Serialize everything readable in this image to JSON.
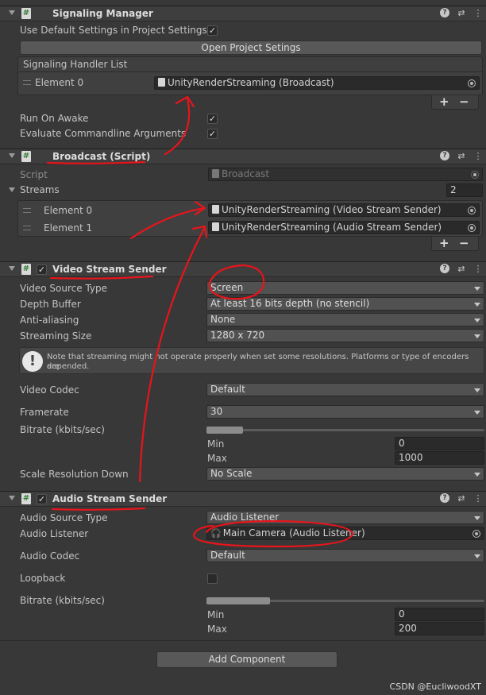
{
  "signaling": {
    "title": "Signaling Manager",
    "use_default_label": "Use Default Settings in Project Settings",
    "open_project_settings": "Open Project Setings",
    "handler_list_label": "Signaling Handler List",
    "element0_label": "Element 0",
    "element0_value": "UnityRenderStreaming (Broadcast)",
    "run_on_awake_label": "Run On Awake",
    "eval_cmd_label": "Evaluate Commandline Arguments",
    "plus": "+",
    "minus": "−"
  },
  "broadcast": {
    "title": "Broadcast (Script)",
    "script_label": "Script",
    "script_value": "Broadcast",
    "streams_label": "Streams",
    "streams_count": "2",
    "element0_label": "Element 0",
    "element0_value": "UnityRenderStreaming (Video Stream Sender)",
    "element1_label": "Element 1",
    "element1_value": "UnityRenderStreaming (Audio Stream Sender)",
    "plus": "+",
    "minus": "−"
  },
  "video": {
    "title": "Video Stream Sender",
    "source_type_label": "Video Source Type",
    "source_type_value": "Screen",
    "depth_label": "Depth Buffer",
    "depth_value": "At least 16 bits depth (no stencil)",
    "aa_label": "Anti-aliasing",
    "aa_value": "None",
    "size_label": "Streaming Size",
    "size_value": "1280 x 720",
    "note_line1": "Note that streaming might not operate properly when set some resolutions. Platforms or type of encoders are",
    "note_line2": "depended.",
    "codec_label": "Video Codec",
    "codec_value": "Default",
    "framerate_label": "Framerate",
    "framerate_value": "30",
    "bitrate_label": "Bitrate (kbits/sec)",
    "min_label": "Min",
    "min_value": "0",
    "max_label": "Max",
    "max_value": "1000",
    "scale_label": "Scale Resolution Down",
    "scale_value": "No Scale"
  },
  "audio": {
    "title": "Audio Stream Sender",
    "source_type_label": "Audio Source Type",
    "source_type_value": "Audio Listener",
    "listener_label": "Audio Listener",
    "listener_value": "Main Camera (Audio Listener)",
    "codec_label": "Audio Codec",
    "codec_value": "Default",
    "loopback_label": "Loopback",
    "bitrate_label": "Bitrate (kbits/sec)",
    "min_label": "Min",
    "min_value": "0",
    "max_label": "Max",
    "max_value": "200"
  },
  "add_component": "Add Component",
  "header_icons": {
    "help": "?",
    "presets": "⇄",
    "more": "⋮"
  },
  "icons": {
    "script": "#",
    "check": "✓",
    "info": "!"
  },
  "watermark": "CSDN @EucliwoodXT",
  "colors": {
    "annotation": "#e8141b",
    "background": "#383838",
    "header": "#3e3e3e"
  }
}
